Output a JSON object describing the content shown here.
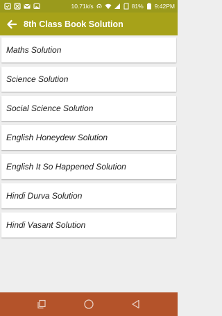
{
  "status_bar": {
    "speed": "10.71k/s",
    "battery_percent": "81%",
    "time": "9:42PM"
  },
  "app_bar": {
    "title": "8th Class Book Solution"
  },
  "list_items": [
    "Maths Solution",
    "Science Solution",
    "Social Science Solution",
    "English Honeydew Solution",
    "English It So Happened Solution",
    "Hindi Durva Solution",
    "Hindi Vasant Solution"
  ],
  "colors": {
    "status_bar": "#9a9a1c",
    "app_bar": "#a7a219",
    "nav_bar": "#b4532a",
    "background": "#eeeeee"
  },
  "nav_icons": [
    "recents-icon",
    "home-icon",
    "back-triangle-icon"
  ]
}
